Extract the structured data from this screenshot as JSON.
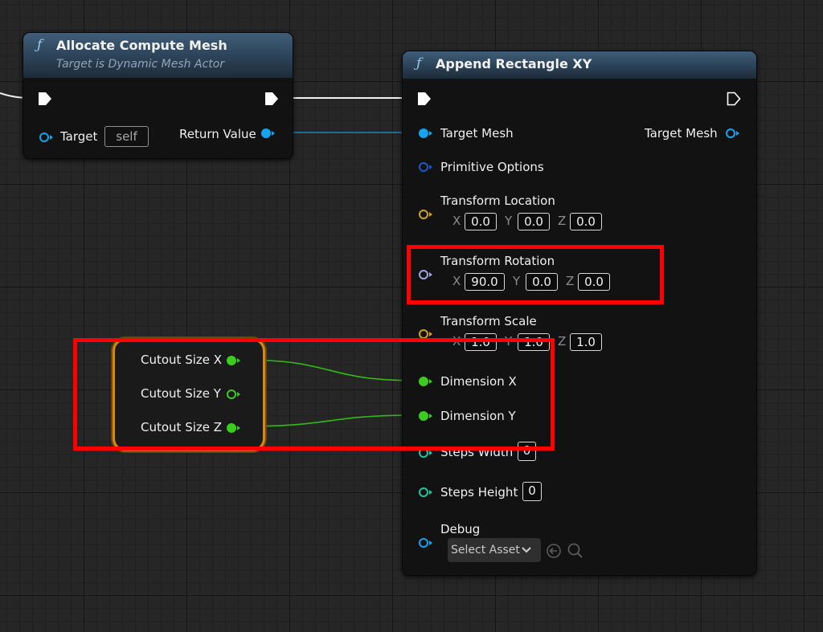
{
  "allocate_node": {
    "fn_icon": "ƒ",
    "title": "Allocate Compute Mesh",
    "subtitle": "Target is Dynamic Mesh Actor",
    "target_label": "Target",
    "target_value": "self",
    "return_label": "Return Value"
  },
  "append_node": {
    "fn_icon": "ƒ",
    "title": "Append Rectangle XY",
    "pins": {
      "target_mesh_in": "Target Mesh",
      "target_mesh_out": "Target Mesh",
      "primitive_options": "Primitive Options",
      "transform_location": "Transform Location",
      "transform_rotation": "Transform Rotation",
      "transform_scale": "Transform Scale",
      "dimension_x": "Dimension X",
      "dimension_y": "Dimension Y",
      "steps_width": "Steps Width",
      "steps_height": "Steps Height",
      "debug": "Debug"
    },
    "location": {
      "x": "0.0",
      "y": "0.0",
      "z": "0.0"
    },
    "rotation": {
      "x": "90.0",
      "y": "0.0",
      "z": "0.0"
    },
    "scale": {
      "x": "1.0",
      "y": "1.0",
      "z": "1.0"
    },
    "steps_width_value": "0",
    "steps_height_value": "0",
    "select_asset": "Select Asset",
    "axis_labels": {
      "x": "X",
      "y": "Y",
      "z": "Z"
    }
  },
  "break_node": {
    "pins": [
      "Cutout Size X",
      "Cutout Size Y",
      "Cutout Size Z"
    ]
  },
  "colors": {
    "exec_wire": "#ffffff",
    "object_pin": "#14a4f0",
    "struct_pin": "#1f57c8",
    "vector_pin": "#d1a325",
    "rotator_pin": "#9fa6e0",
    "float_pin": "#3bcc1e",
    "int_pin": "#1fc79f",
    "highlight": "#ff0000"
  }
}
